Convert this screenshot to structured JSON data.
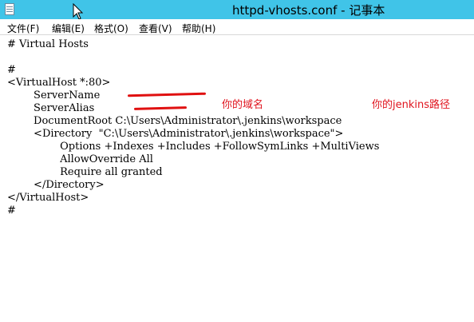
{
  "window": {
    "title": "httpd-vhosts.conf - 记事本"
  },
  "menu": [
    "文件(F)",
    "编辑(E)",
    "格式(O)",
    "查看(V)",
    "帮助(H)"
  ],
  "code_lines": [
    "# Virtual Hosts",
    "",
    "#",
    "<VirtualHost *:80>",
    "        ServerName ",
    "        ServerAlias ",
    "        DocumentRoot C:\\Users\\Administrator\\.jenkins\\workspace",
    "        <Directory  \"C:\\Users\\Administrator\\.jenkins\\workspace\">",
    "                Options +Indexes +Includes +FollowSymLinks +MultiViews",
    "                AllowOverride All",
    "                Require all granted",
    "        </Directory>",
    "</VirtualHost>",
    "#"
  ],
  "annotations": {
    "domain_note": "你的域名",
    "jenkins_path_note": "你的jenkins路径"
  },
  "colors": {
    "titlebar": "#40c4e8",
    "annotation": "#e0141e"
  }
}
